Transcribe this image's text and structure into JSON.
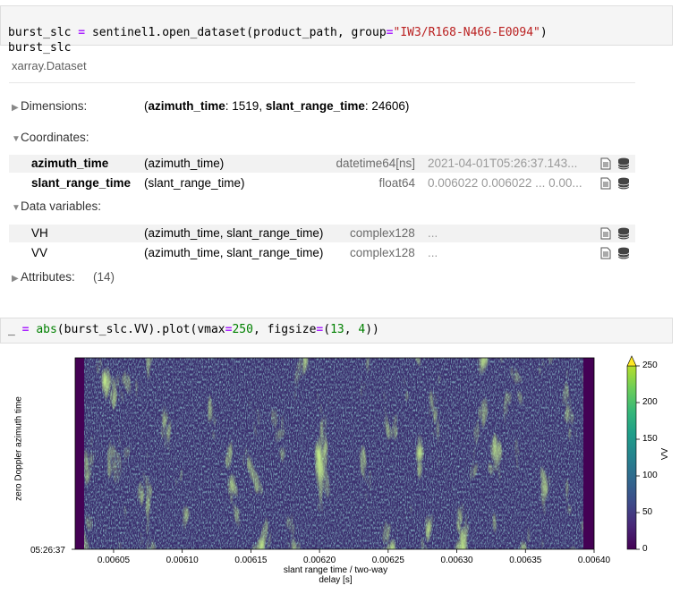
{
  "cell1": {
    "line1_var": "burst_slc",
    "line1_eq": "=",
    "line1_call": "sentinel1.open_dataset(product_path, group",
    "line1_eq2": "=",
    "line1_str": "\"IW3/R168-N466-E0094\"",
    "line1_close": ")",
    "line2": "burst_slc"
  },
  "dataset": {
    "title": "xarray.Dataset",
    "dimensions_label": "Dimensions:",
    "dim1_name": "azimuth_time",
    "dim1_val": ": 1519, ",
    "dim2_name": "slant_range_time",
    "dim2_val": ": 24606)",
    "dims_open": "(",
    "coordinates_label": "Coordinates:",
    "coords": [
      {
        "name": "azimuth_time",
        "dims": "(azimuth_time)",
        "dtype": "datetime64[ns]",
        "preview": "2021-04-01T05:26:37.143..."
      },
      {
        "name": "slant_range_time",
        "dims": "(slant_range_time)",
        "dtype": "float64",
        "preview": "0.006022 0.006022 ... 0.00..."
      }
    ],
    "data_vars_label": "Data variables:",
    "data_vars": [
      {
        "name": "VH",
        "dims": "(azimuth_time, slant_range_time)",
        "dtype": "complex128",
        "preview": "..."
      },
      {
        "name": "VV",
        "dims": "(azimuth_time, slant_range_time)",
        "dtype": "complex128",
        "preview": "..."
      }
    ],
    "attributes_label": "Attributes:",
    "attributes_count": "(14)",
    "icons": {
      "attrs": "file-text-icon",
      "data": "database-icon"
    }
  },
  "cell2": {
    "a": "_ ",
    "eq": "=",
    "b": " ",
    "abs": "abs",
    "c": "(burst_slc.VV).plot(vmax",
    "eq2": "=",
    "n250": "250",
    "d": ", figsize",
    "eq3": "=",
    "e": "(",
    "n13": "13",
    "f": ", ",
    "n4": "4",
    "g": "))"
  },
  "chart_data": {
    "type": "heatmap",
    "xlabel": "slant range time / two-way\ndelay [s]",
    "xlabel_line1": "slant range time / two-way",
    "xlabel_line2": "delay [s]",
    "ylabel": "zero Doppler azimuth time",
    "x_ticks": [
      "0.00605",
      "0.00610",
      "0.00615",
      "0.00620",
      "0.00625",
      "0.00630",
      "0.00635",
      "0.00640"
    ],
    "x_tick_values": [
      0.00605,
      0.0061,
      0.00615,
      0.0062,
      0.00625,
      0.0063,
      0.00635,
      0.0064
    ],
    "xlim": [
      0.006022,
      0.0064
    ],
    "y_ticks": [
      "05:26:37"
    ],
    "colorbar_label": "VV",
    "colorbar_ticks": [
      0,
      50,
      100,
      150,
      200,
      250
    ],
    "vmin": 0,
    "vmax": 250,
    "colormap": "viridis",
    "colorbar_extend": "max"
  }
}
